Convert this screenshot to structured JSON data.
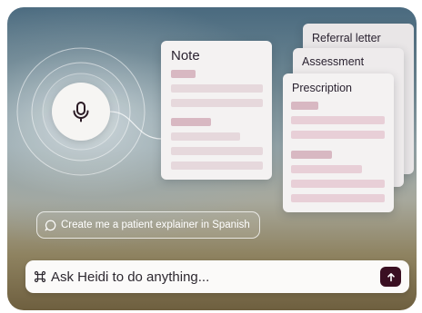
{
  "note_card": {
    "title": "Note"
  },
  "referral_card": {
    "title": "Referral letter"
  },
  "assessment_card": {
    "title": "Assessment"
  },
  "prescription_card": {
    "title": "Prescription"
  },
  "suggestion_chip": {
    "label": "Create me a patient explainer in Spanish",
    "icon": "chat-bubble-icon"
  },
  "prompt_bar": {
    "placeholder": "Ask Heidi to do anything...",
    "command_icon": "command-key-icon",
    "send_icon": "arrow-up-icon"
  },
  "mic": {
    "icon": "microphone-icon"
  },
  "colors": {
    "send_button": "#3a0f22",
    "placeholder_bar_pink": "#d8b8c2",
    "placeholder_bar_light": "#e6d8dc",
    "card_background": "#f4f2f2"
  }
}
